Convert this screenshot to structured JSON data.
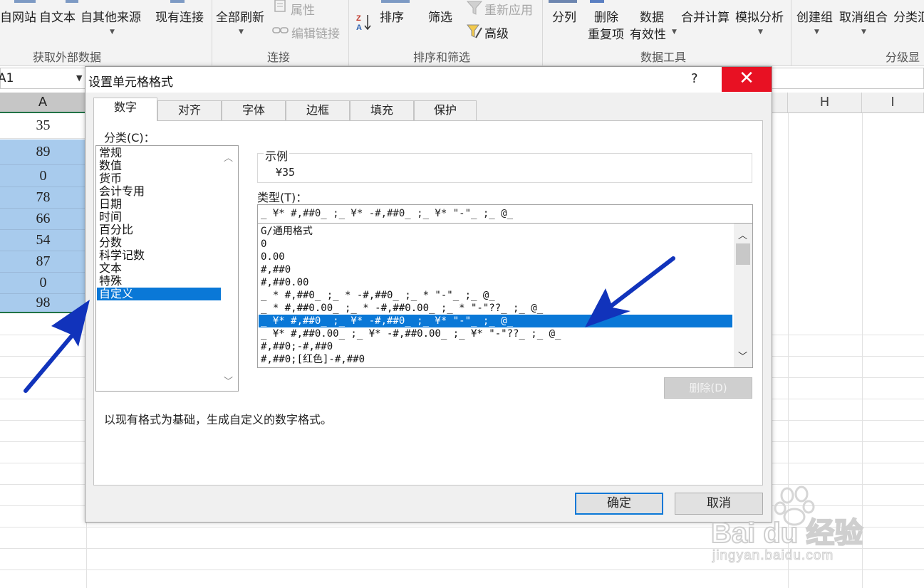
{
  "ribbon": {
    "buttons": {
      "from_web": "自网站",
      "from_text": "自文本",
      "from_other": "自其他来源",
      "existing_conn": "现有连接",
      "refresh_all": "全部刷新",
      "properties": "属性",
      "edit_links": "编辑链接",
      "sort": "排序",
      "filter": "筛选",
      "reapply": "重新应用",
      "advanced": "高级",
      "text_to_cols": "分列",
      "remove_dup_1": "删除",
      "remove_dup_2": "重复项",
      "validation_1": "数据",
      "validation_2": "有效性",
      "consolidate": "合并计算",
      "what_if": "模拟分析",
      "group": "创建组",
      "ungroup": "取消组合",
      "subtotal": "分类汇"
    },
    "groups": {
      "get_external": "获取外部数据",
      "connections": "连接",
      "sort_filter": "排序和筛选",
      "data_tools": "数据工具",
      "outline": "分级显"
    }
  },
  "namebox": "A1",
  "columns": {
    "a": "A",
    "h": "H",
    "i": "I"
  },
  "cells": [
    "35",
    "89",
    "0",
    "78",
    "66",
    "54",
    "87",
    "0",
    "98"
  ],
  "dialog": {
    "title": "设置单元格格式",
    "help": "?",
    "close": "✕",
    "tabs": [
      "数字",
      "对齐",
      "字体",
      "边框",
      "填充",
      "保护"
    ],
    "category_label": "分类(C)：",
    "categories": [
      "常规",
      "数值",
      "货币",
      "会计专用",
      "日期",
      "时间",
      "百分比",
      "分数",
      "科学记数",
      "文本",
      "特殊",
      "自定义"
    ],
    "sample_label": "示例",
    "sample_value": "¥35",
    "type_label": "类型(T)：",
    "type_value": "_ ¥* #,##0_ ;_ ¥* -#,##0_ ;_ ¥* \"-\"_ ;_ @_",
    "formats": [
      "G/通用格式",
      "0",
      "0.00",
      "#,##0",
      "#,##0.00",
      "_ * #,##0_ ;_ * -#,##0_ ;_ * \"-\"_ ;_ @_",
      "_ * #,##0.00_ ;_ * -#,##0.00_ ;_ * \"-\"??_ ;_ @_",
      "_ ¥* #,##0_ ;_ ¥* -#,##0_ ;_ ¥* \"-\"_ ;_ @_",
      "_ ¥* #,##0.00_ ;_ ¥* -#,##0.00_ ;_ ¥* \"-\"??_ ;_ @_",
      "#,##0;-#,##0",
      "#,##0;[红色]-#,##0"
    ],
    "delete_btn": "删除(D)",
    "description": "以现有格式为基础，生成自定义的数字格式。",
    "ok": "确定",
    "cancel": "取消"
  },
  "watermark": {
    "brand": "Bai du 经验",
    "url": "jingyan.baidu.com"
  },
  "colors": {
    "selection": "#0a78d7",
    "close": "#e81123",
    "arrow": "#1133bb",
    "cell_highlight": "#a8cbed"
  }
}
